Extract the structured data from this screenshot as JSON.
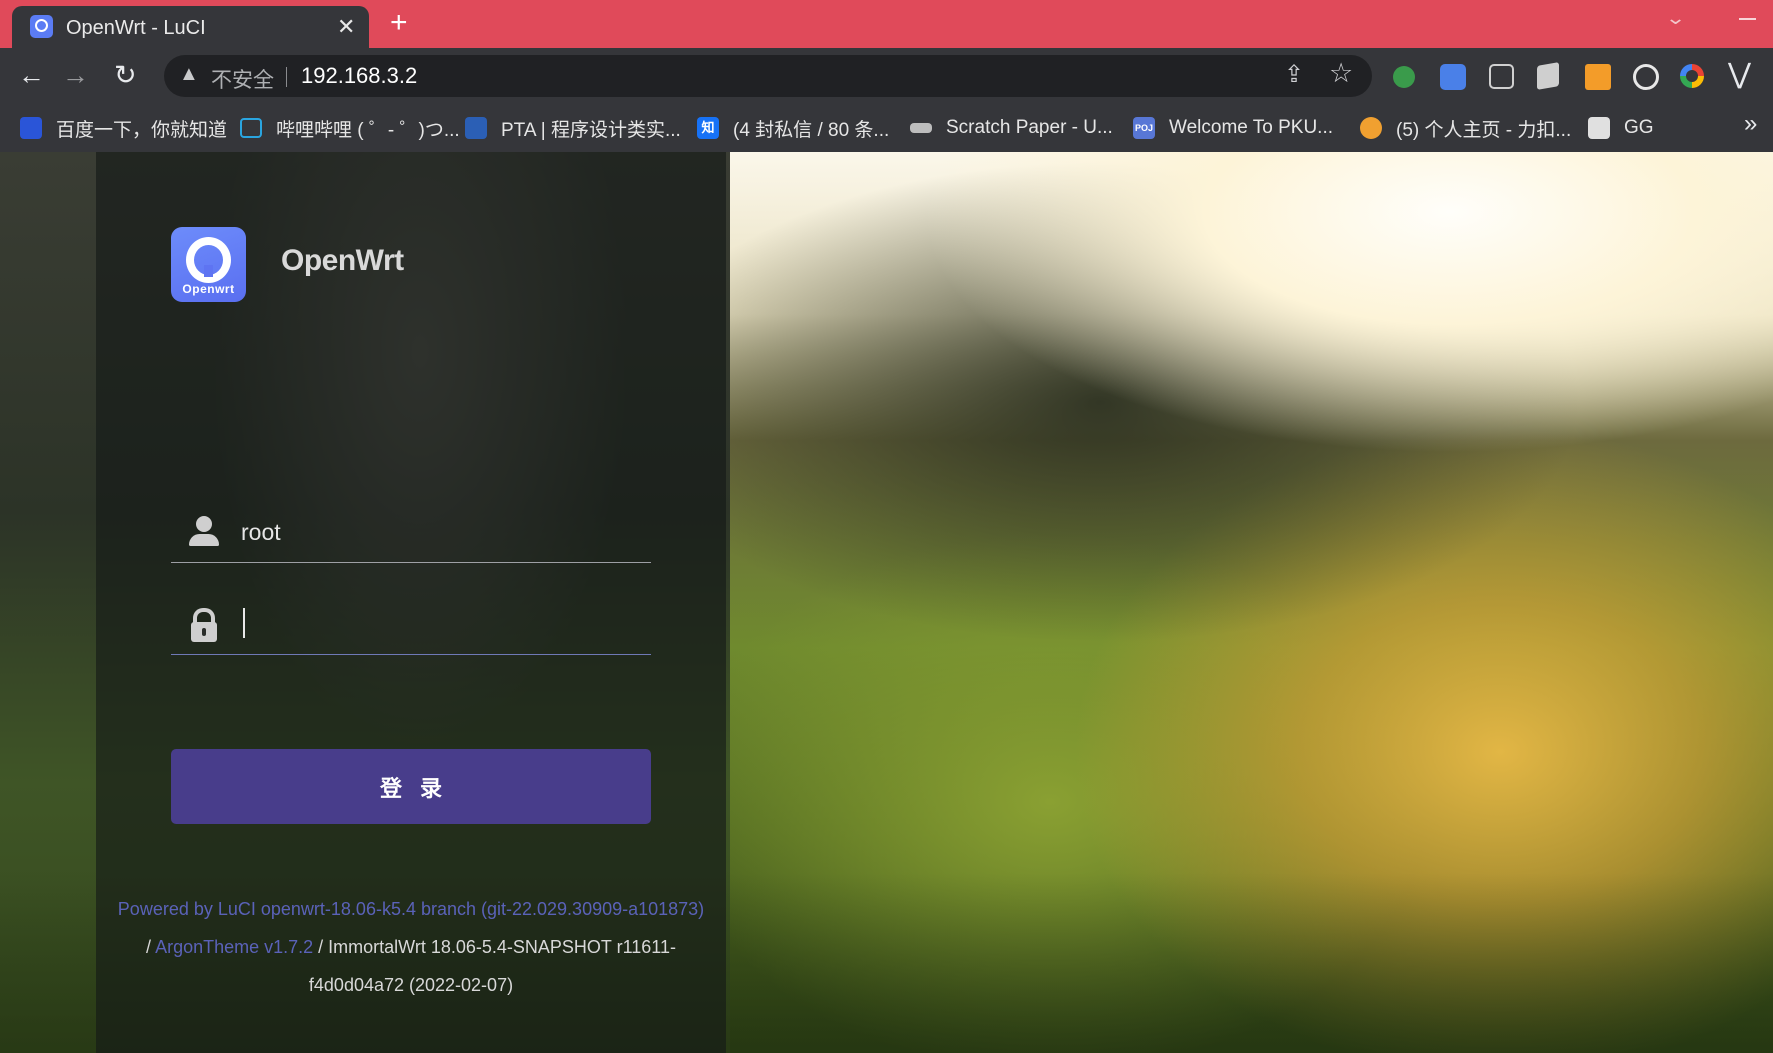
{
  "browser": {
    "tab": {
      "title": "OpenWrt - LuCI",
      "close_glyph": "✕"
    },
    "new_tab_glyph": "+",
    "nav": {
      "back": "←",
      "forward": "→",
      "reload": "↻"
    },
    "omnibox": {
      "security_label": "不安全",
      "url": "192.168.3.2"
    },
    "bookmarks": [
      {
        "label": "百度一下，你就知道",
        "icon": "baidu-paw-icon",
        "color": "#2a55d8"
      },
      {
        "label": "哔哩哔哩 ( ゜- ゜)つ...",
        "icon": "bilibili-tv-icon",
        "color": "#2aa5e0"
      },
      {
        "label": "PTA | 程序设计类实...",
        "icon": "pta-icon",
        "color": "#2b5fb5"
      },
      {
        "label": "(4 封私信 / 80 条...",
        "icon": "zhihu-icon",
        "color": "#1772f6",
        "glyph": "知"
      },
      {
        "label": "Scratch Paper - U...",
        "icon": "keyboard-icon",
        "color": "#bdbdbd"
      },
      {
        "label": "Welcome To PKU...",
        "icon": "poj-icon",
        "color": "#5877d6",
        "glyph": "POJ"
      },
      {
        "label": "(5) 个人主页 - 力扣...",
        "icon": "leetcode-icon",
        "color": "#f0a030"
      },
      {
        "label": "GG",
        "icon": "gg-icon",
        "color": "#e0e0e0"
      }
    ],
    "bookmarks_more": "»"
  },
  "login": {
    "brand_badge_text": "Openwrt",
    "brand_name": "OpenWrt",
    "username_value": "root",
    "password_value": "",
    "submit_label": "登录"
  },
  "footer": {
    "luci_link": "Powered by LuCI openwrt-18.06-k5.4 branch (git-22.029.30909-a101873)",
    "sep1": "/",
    "theme_link": "ArgonTheme v1.7.2",
    "firmware_a": " / ImmortalWrt 18.06-5.4-SNAPSHOT r11611-",
    "firmware_b": "f4d0d04a72 (2022-02-07)"
  },
  "colors": {
    "tabbar": "#e04a5a",
    "chrome": "#35363a",
    "login_button": "#483d8b",
    "link": "#5a62b8"
  }
}
